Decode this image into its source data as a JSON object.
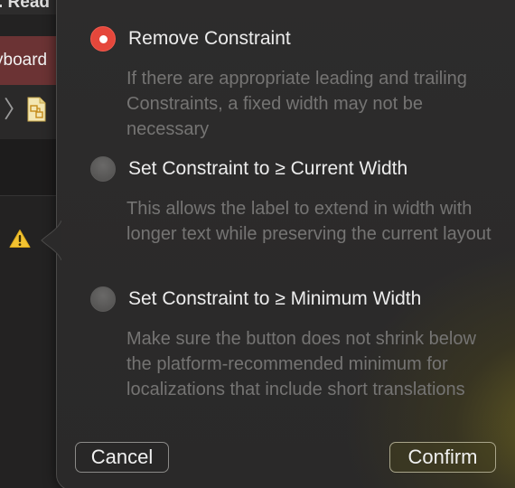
{
  "background": {
    "title_fragment": ". Read",
    "selected_item_fragment": "yboard",
    "row_chevron": "chevron-right-icon",
    "row_file_icon": "storyboard-file-icon",
    "warning_icon": "warning-triangle-icon"
  },
  "popover": {
    "options": [
      {
        "label": "Remove Constraint",
        "description": "If there are appropriate leading and trailing Constraints, a fixed width may not be necessary",
        "selected": true
      },
      {
        "label": "Set Constraint to ≥ Current Width",
        "description": "This allows the label to extend in width with longer text while preserving the current layout",
        "selected": false
      },
      {
        "label": "Set Constraint to ≥ Minimum Width",
        "description": "Make sure the button does not shrink below the platform-recommended minimum for localizations that include short translations",
        "selected": false
      }
    ],
    "cancel_label": "Cancel",
    "confirm_label": "Confirm"
  },
  "colors": {
    "radio_selected": "#e5473b",
    "selected_row_bg": "#6b3334",
    "warning_yellow": "#f2c230"
  }
}
